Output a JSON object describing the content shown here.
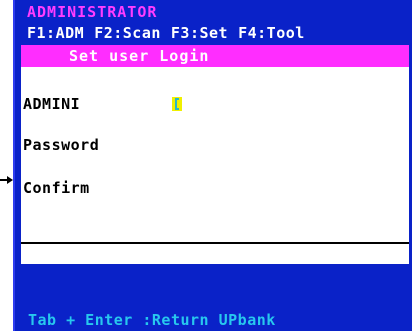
{
  "title": "ADMINISTRATOR",
  "menu": [
    {
      "label": "F1:ADM"
    },
    {
      "label": "F2:Scan"
    },
    {
      "label": "F3:Set"
    },
    {
      "label": "F4:Tool"
    }
  ],
  "dialog": {
    "header": "Set user Login",
    "fields": [
      {
        "label": "ADMINI",
        "value": ""
      },
      {
        "label": "Password",
        "value": ""
      },
      {
        "label": "Confirm",
        "value": ""
      }
    ]
  },
  "footer": "Tab + Enter :Return UPbank",
  "colors": {
    "background": "#0a22c8",
    "title": "#ff3cff",
    "header_bar": "#ff2dff",
    "footer_text": "#27c8ee",
    "cursor": "#f0f000"
  }
}
